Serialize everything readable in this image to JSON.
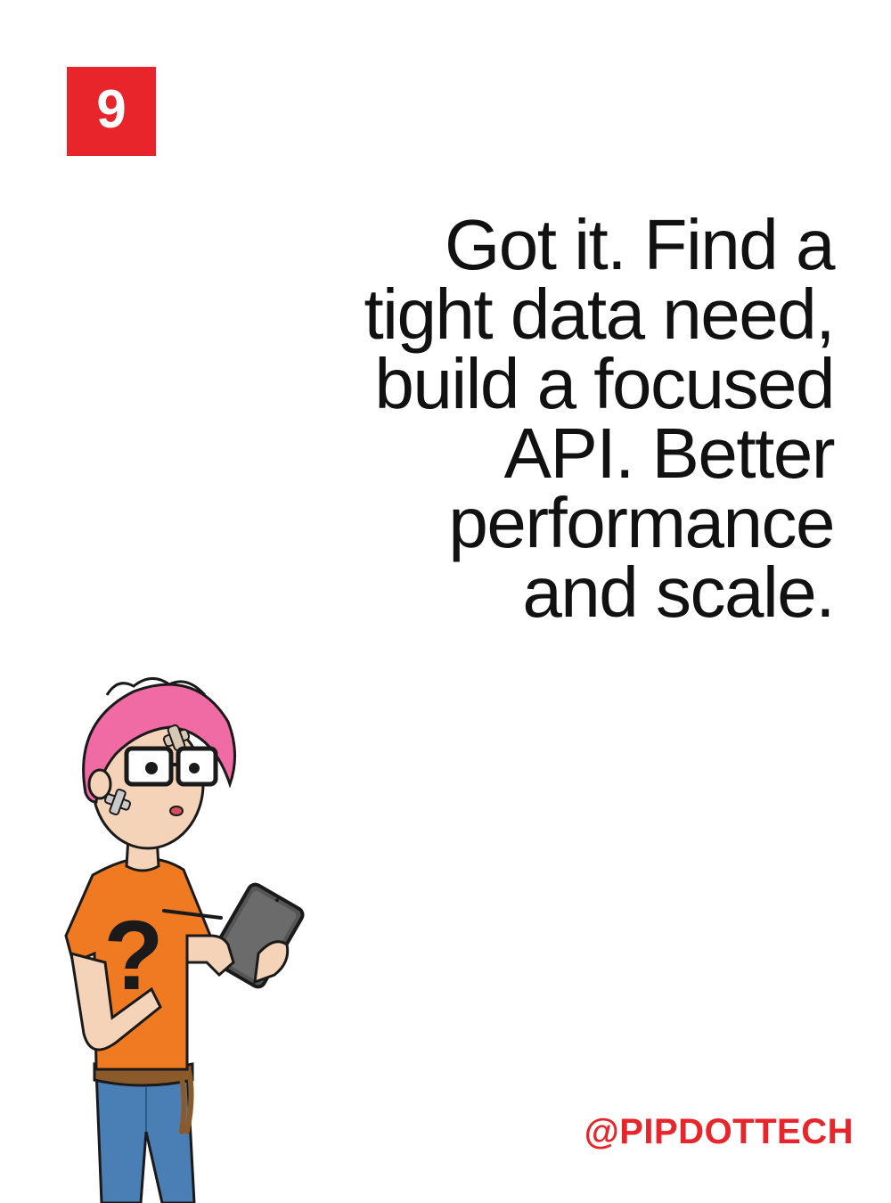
{
  "badge": {
    "number": "9",
    "color": "#e8252b"
  },
  "headline": {
    "lines": [
      "Got it. Find a",
      "tight data need,",
      "build a focused",
      "API. Better",
      "performance",
      "and scale."
    ]
  },
  "footer": {
    "handle": "@PIPDOTTECH",
    "color": "#e8252b"
  },
  "illustration": {
    "icon": "character-with-tablet-illustration",
    "shirt_mark": "?"
  }
}
